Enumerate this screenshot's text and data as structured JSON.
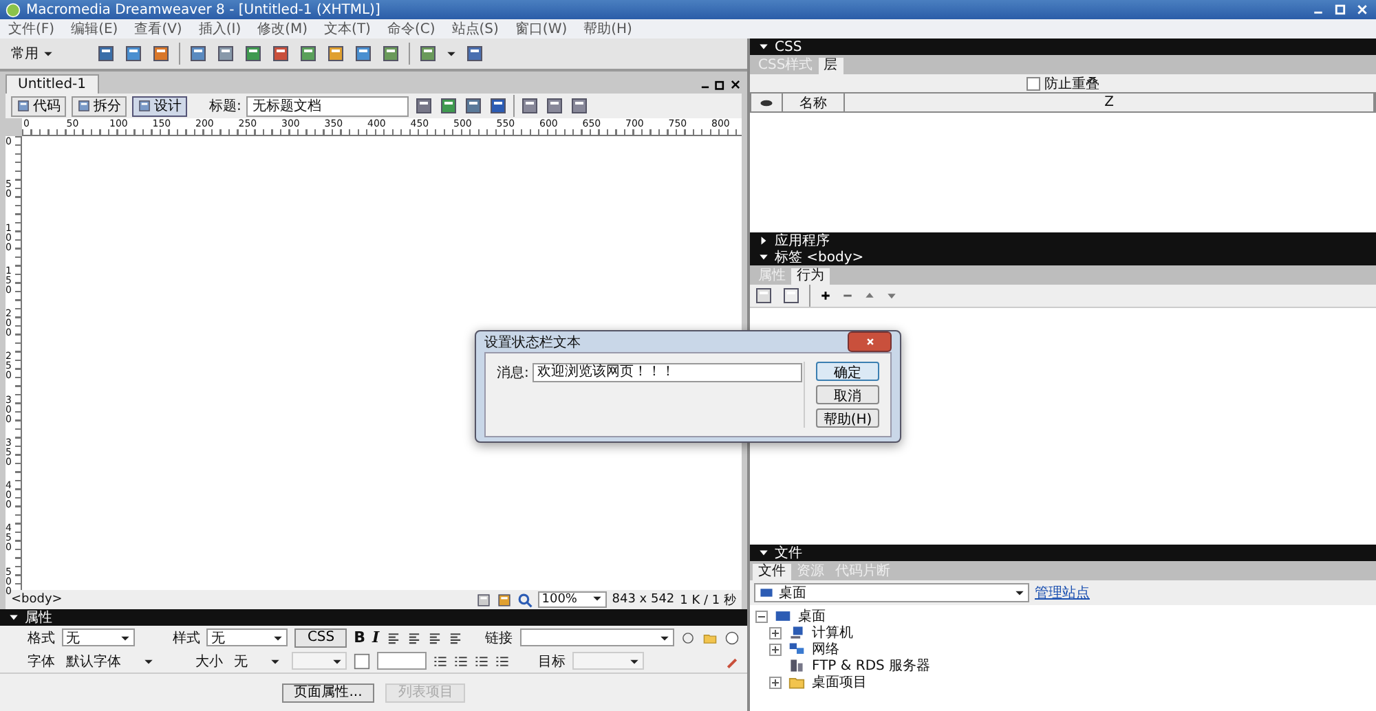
{
  "window": {
    "title": "Macromedia Dreamweaver 8 - [Untitled-1 (XHTML)]"
  },
  "menu": [
    "文件(F)",
    "编辑(E)",
    "查看(V)",
    "插入(I)",
    "修改(M)",
    "文本(T)",
    "命令(C)",
    "站点(S)",
    "窗口(W)",
    "帮助(H)"
  ],
  "insert_bar": {
    "category": "常用"
  },
  "document": {
    "tab": "Untitled-1",
    "views": [
      {
        "label": "代码",
        "selected": false
      },
      {
        "label": "拆分",
        "selected": false
      },
      {
        "label": "设计",
        "selected": true
      }
    ],
    "title_label": "标题:",
    "title_value": "无标题文档",
    "ruler_h": [
      "0",
      "50",
      "100",
      "150",
      "200",
      "250",
      "300",
      "350",
      "400",
      "450",
      "500",
      "550",
      "600",
      "650",
      "700",
      "750",
      "800"
    ],
    "ruler_v": [
      "0",
      "50",
      "100",
      "150",
      "200",
      "250",
      "300",
      "350",
      "400",
      "450",
      "500"
    ]
  },
  "status_bar": {
    "tag": "<body>",
    "zoom": "100%",
    "size": "843 x 542",
    "download": "1 K / 1 秒"
  },
  "properties": {
    "title": "属性",
    "expanded": true,
    "format_label": "格式",
    "format_value": "无",
    "style_label": "样式",
    "style_value": "无",
    "css_button": "CSS",
    "bold": "B",
    "italic": "I",
    "link_label": "链接",
    "font_label": "字体",
    "font_value": "默认字体",
    "size_label": "大小",
    "size_value": "无",
    "target_label": "目标",
    "buttons": [
      {
        "label": "页面属性...",
        "disabled": false
      },
      {
        "label": "列表项目",
        "disabled": true
      }
    ]
  },
  "css_panel": {
    "title": "CSS",
    "expanded": true,
    "tabs": [
      {
        "label": "CSS样式",
        "selected": false
      },
      {
        "label": "层",
        "selected": true
      }
    ],
    "prevent_overlap": {
      "label": "防止重叠",
      "checked": false
    },
    "columns": [
      "名称",
      "Z"
    ]
  },
  "app_panel": {
    "title": "应用程序",
    "expanded": false
  },
  "tag_panel": {
    "title": "标签 <body>",
    "expanded": true,
    "tabs": [
      {
        "label": "属性",
        "selected": false
      },
      {
        "label": "行为",
        "selected": true
      }
    ]
  },
  "files_panel": {
    "title": "文件",
    "expanded": true,
    "tabs": [
      {
        "label": "文件",
        "selected": true
      },
      {
        "label": "资源",
        "selected": false
      },
      {
        "label": "代码片断",
        "selected": false
      }
    ],
    "site": "桌面",
    "manage_link": "管理站点",
    "tree": [
      {
        "label": "桌面",
        "kind": "desktop",
        "expanded": true,
        "children": [
          {
            "label": "计算机",
            "kind": "computer",
            "expanded": false
          },
          {
            "label": "网络",
            "kind": "network",
            "expanded": false
          },
          {
            "label": "FTP & RDS 服务器",
            "kind": "server"
          },
          {
            "label": "桌面项目",
            "kind": "folder",
            "expanded": false
          }
        ]
      }
    ]
  },
  "dialog": {
    "title": "设置状态栏文本",
    "message_label": "消息:",
    "message_value": "欢迎浏览该网页！！！",
    "buttons": [
      {
        "label": "确定",
        "default": true
      },
      {
        "label": "取消",
        "default": false
      },
      {
        "label": "帮助(H)",
        "default": false
      }
    ]
  }
}
